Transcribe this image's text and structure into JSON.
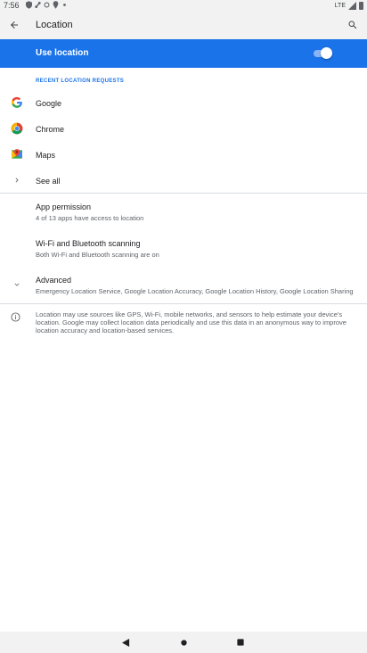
{
  "status_bar": {
    "time": "7:56",
    "network": "LTE"
  },
  "app_bar": {
    "title": "Location"
  },
  "master_switch": {
    "label": "Use location",
    "enabled": true
  },
  "recent_requests": {
    "header": "RECENT LOCATION REQUESTS",
    "items": [
      {
        "label": "Google",
        "icon": "google-icon"
      },
      {
        "label": "Chrome",
        "icon": "chrome-icon"
      },
      {
        "label": "Maps",
        "icon": "maps-icon"
      }
    ],
    "see_all": "See all"
  },
  "settings": {
    "app_permission": {
      "title": "App permission",
      "summary": "4 of 13 apps have access to location"
    },
    "scanning": {
      "title": "Wi-Fi and Bluetooth scanning",
      "summary": "Both Wi-Fi and Bluetooth scanning are on"
    },
    "advanced": {
      "title": "Advanced",
      "summary": "Emergency Location Service, Google Location Accuracy, Google Location History, Google Location Sharing"
    }
  },
  "footer": {
    "text": "Location may use sources like GPS, Wi-Fi, mobile networks, and sensors to help estimate your device's location. Google may collect location data periodically and use this data in an anonymous way to improve location accuracy and location-based services."
  },
  "colors": {
    "accent": "#1a73e8",
    "bar_bg": "#f2f2f2"
  }
}
